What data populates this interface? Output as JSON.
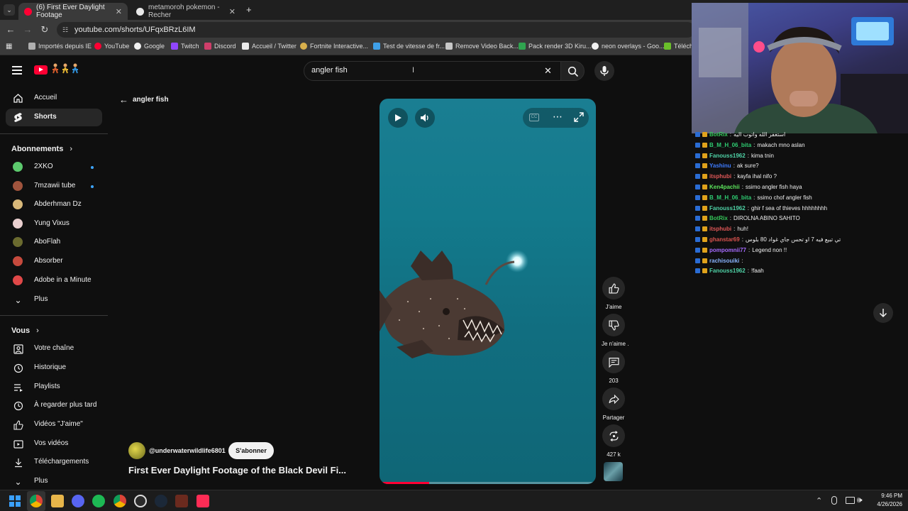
{
  "browser": {
    "tabs": [
      {
        "title": "(6) First Ever Daylight Footage",
        "active": true
      },
      {
        "title": "metamoroh pokemon - Recher",
        "active": false
      }
    ],
    "url": "youtube.com/shorts/UFqxBRzL6IM",
    "bookmarks": [
      "Importés depuis IE",
      "YouTube",
      "Google",
      "Twitch",
      "Discord",
      "Accueil / Twitter",
      "Fortnite Interactive...",
      "Test de vitesse de fr...",
      "Remove Video Back...",
      "Pack render 3D Kiru...",
      "neon overlays - Goo...",
      "Télécha"
    ]
  },
  "youtube": {
    "search": {
      "value": "angler fish"
    },
    "back_label": "angler fish",
    "sidebar": {
      "nav": [
        {
          "label": "Accueil",
          "icon": "home-icon"
        },
        {
          "label": "Shorts",
          "icon": "shorts-icon",
          "active": true
        }
      ],
      "subscriptions_title": "Abonnements",
      "subscriptions": [
        {
          "label": "2XKO",
          "new": true
        },
        {
          "label": "7mzawii tube",
          "new": true
        },
        {
          "label": "Abderhman Dz"
        },
        {
          "label": "Yung Vixus"
        },
        {
          "label": "AboFlah"
        },
        {
          "label": "Absorber"
        },
        {
          "label": "Adobe in a Minute"
        },
        {
          "label": "Plus"
        }
      ],
      "you_title": "Vous",
      "you_items": [
        {
          "label": "Votre chaîne",
          "icon": "channel-icon"
        },
        {
          "label": "Historique",
          "icon": "history-icon"
        },
        {
          "label": "Playlists",
          "icon": "playlist-icon"
        },
        {
          "label": "À regarder plus tard",
          "icon": "watch-later-icon"
        },
        {
          "label": "Vidéos \"J'aime\"",
          "icon": "like-icon"
        },
        {
          "label": "Vos vidéos",
          "icon": "videos-icon"
        },
        {
          "label": "Téléchargements",
          "icon": "download-icon"
        },
        {
          "label": "Plus",
          "icon": "chevron-down-icon"
        }
      ]
    },
    "short": {
      "channel": "@underwaterwildlife6801",
      "subscribe_label": "S'abonner",
      "title": "First Ever Daylight Footage of the Black Devil Fi...",
      "progress_fraction": 0.23
    },
    "actions": [
      {
        "label": "J'aime",
        "icon": "thumbs-up-icon"
      },
      {
        "label": "Je n'aime .",
        "icon": "thumbs-down-icon"
      },
      {
        "label": "203",
        "icon": "comment-icon"
      },
      {
        "label": "Partager",
        "icon": "share-icon"
      },
      {
        "label": "427 k",
        "icon": "remix-icon"
      }
    ]
  },
  "chat": {
    "messages": [
      {
        "user": "BotRix",
        "text": "استغفر الله واتوب اليه",
        "color": "#34c759"
      },
      {
        "user": "B_M_H_06_bita",
        "text": "makach mno aslan",
        "color": "#2ecc71"
      },
      {
        "user": "Fanouss1962",
        "text": "kima tnin",
        "color": "#4fd2a6"
      },
      {
        "user": "Yashinu",
        "text": "ak sure?",
        "color": "#3d7bff"
      },
      {
        "user": "itsphubi",
        "text": "kayfa ihal nifo ?",
        "color": "#e05757"
      },
      {
        "user": "Ken4pachii",
        "text": "ssimo angler fish haya",
        "color": "#5ce35c"
      },
      {
        "user": "B_M_H_06_bita",
        "text": "ssimo chof angler fish",
        "color": "#2ecc71"
      },
      {
        "user": "Fanouss1962",
        "text": "ghir f sea of thieves hhhhhhhh",
        "color": "#4fd2a6"
      },
      {
        "user": "BotRix",
        "text": "DIROLNA ABINO SAHITO",
        "color": "#34c759"
      },
      {
        "user": "itsphubi",
        "text": "huh!",
        "color": "#e05757"
      },
      {
        "user": "ghanstar69",
        "text": "تي تبيع فيه 7 او تحس جاي غواد 80 بلوس",
        "color": "#d9534f"
      },
      {
        "user": "pompomnii77",
        "text": "Legend non !!",
        "color": "#a66bff"
      },
      {
        "user": "rachisouiki",
        "text": "",
        "color": "#8ab4ff"
      },
      {
        "user": "Fanouss1962",
        "text": "!faah",
        "color": "#4fd2a6"
      }
    ]
  },
  "taskbar": {
    "time": "9:46 PM",
    "date": "4/26/2026"
  }
}
